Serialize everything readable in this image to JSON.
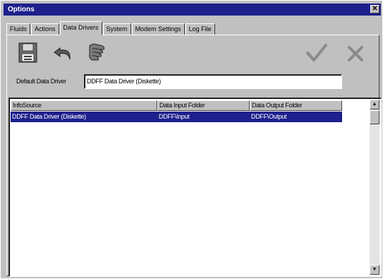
{
  "window": {
    "title": "Options"
  },
  "tabs": [
    {
      "label": "Fluids"
    },
    {
      "label": "Actions"
    },
    {
      "label": "Data Drivers",
      "active": true
    },
    {
      "label": "System"
    },
    {
      "label": "Modem Settings"
    },
    {
      "label": "Log File"
    }
  ],
  "toolbar": {
    "icons": [
      "save-icon",
      "undo-icon",
      "settings-hand-icon",
      "checkmark-icon",
      "cancel-x-icon"
    ]
  },
  "default_driver": {
    "label": "Default Data Driver",
    "value": "DDFF Data Driver (Diskette)"
  },
  "table": {
    "columns": [
      "InfoSource",
      "Data Input Folder",
      "Data Output Folder"
    ],
    "rows": [
      {
        "info_source": "DDFF Data Driver (Diskette)",
        "input_folder": "DDFF\\Input",
        "output_folder": "DDFF\\Output",
        "selected": true
      }
    ]
  },
  "colors": {
    "title_bar": "#1d1f8c",
    "selection": "#1d1f8c",
    "face": "#c0c0c0"
  }
}
